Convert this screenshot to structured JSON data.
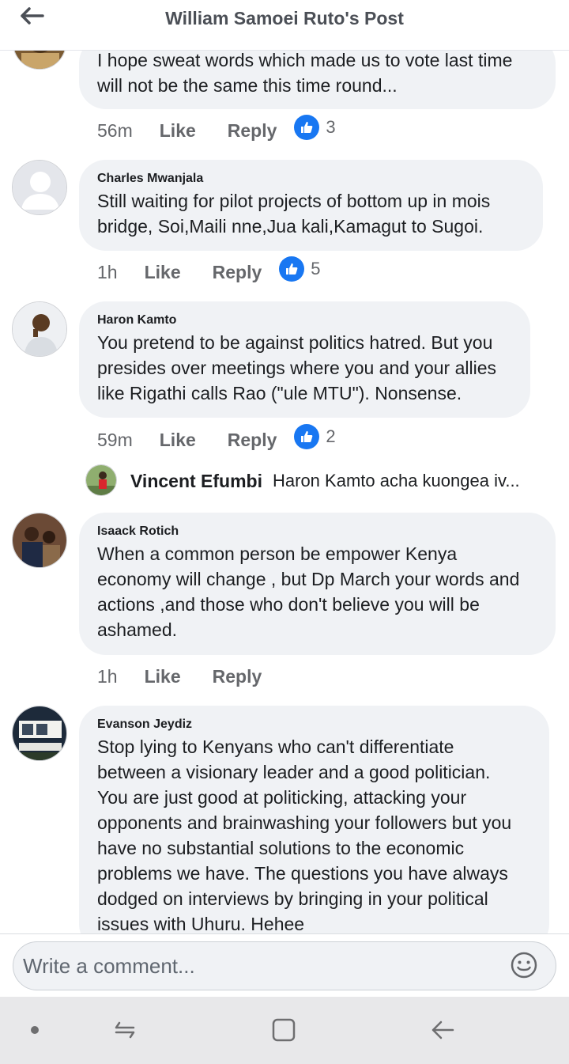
{
  "header": {
    "title": "William Samoei Ruto's Post"
  },
  "comments": [
    {
      "author": "",
      "text": "I hope sweat words which made us to vote last time\nwill not be the same this time round...",
      "time": "56m",
      "like_label": "Like",
      "reply_label": "Reply",
      "reaction_count": "3"
    },
    {
      "author": "Charles Mwanjala",
      "text": "Still waiting for pilot projects of bottom up in mois\nbridge, Soi,Maili nne,Jua kali,Kamagut to Sugoi.",
      "time": "1h",
      "like_label": "Like",
      "reply_label": "Reply",
      "reaction_count": "5"
    },
    {
      "author": "Haron Kamto",
      "text": "You pretend to be against politics hatred. But you\npresides over meetings where you and your allies\nlike Rigathi calls Rao (\"ule MTU\"). Nonsense.",
      "time": "59m",
      "like_label": "Like",
      "reply_label": "Reply",
      "reaction_count": "2",
      "reply_preview": {
        "author": "Vincent Efumbi",
        "text": "Haron Kamto acha kuongea iv..."
      }
    },
    {
      "author": "Isaack Rotich",
      "text": "When a common person be empower Kenya\neconomy will change , but Dp March your words and\nactions ,and those who don't believe you will be\nashamed.",
      "time": "1h",
      "like_label": "Like",
      "reply_label": "Reply"
    },
    {
      "author": "Evanson Jeydiz",
      "text": "Stop lying to Kenyans who can't differentiate\nbetween a visionary leader and a good politician.\nYou are just good at politicking, attacking your\nopponents and brainwashing your followers but you\nhave no substantial solutions to the economic\nproblems we have. The questions you have always\ndodged on interviews by bringing in your political\nissues with Uhuru. Hehee"
    }
  ],
  "composer": {
    "placeholder": "Write a comment..."
  },
  "icons": {
    "back": "arrow-left-icon",
    "like": "thumbs-up-icon",
    "emoji": "smiley-icon",
    "nav_dot": "dot-icon",
    "nav_recents": "recents-icon",
    "nav_home": "home-square-icon",
    "nav_back": "nav-back-icon"
  },
  "colors": {
    "like_blue": "#1877f2",
    "bubble_bg": "#f0f2f5",
    "meta_gray": "#65676b"
  }
}
